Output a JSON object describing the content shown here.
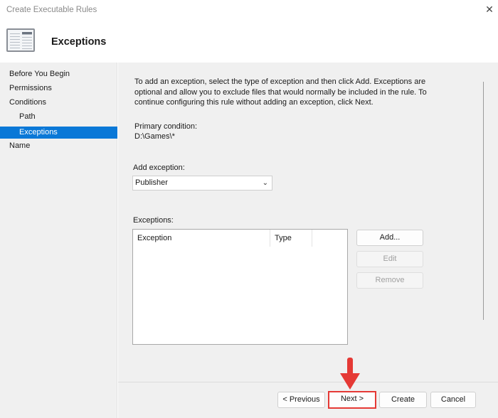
{
  "window": {
    "title": "Create Executable Rules",
    "close_icon": "close-icon"
  },
  "header": {
    "title": "Exceptions",
    "icon": "wizard-page-icon"
  },
  "sidebar": {
    "items": [
      {
        "label": "Before You Begin",
        "selected": false,
        "indent": false
      },
      {
        "label": "Permissions",
        "selected": false,
        "indent": false
      },
      {
        "label": "Conditions",
        "selected": false,
        "indent": false
      },
      {
        "label": "Path",
        "selected": false,
        "indent": true
      },
      {
        "label": "Exceptions",
        "selected": true,
        "indent": true
      },
      {
        "label": "Name",
        "selected": false,
        "indent": false
      }
    ]
  },
  "main": {
    "description_lines": [
      "To add an exception, select the type of exception and then click Add. Exceptions are",
      "optional and allow you to exclude files that would normally be included in the rule. To",
      "continue configuring this rule without adding an exception, click Next."
    ],
    "primary_condition_label": "Primary condition:",
    "primary_condition_value": "D:\\Games\\*",
    "add_exception_label": "Add exception:",
    "add_exception_value": "Publisher",
    "exceptions_label": "Exceptions:",
    "columns": [
      "Exception",
      "Type"
    ],
    "buttons": {
      "add": "Add...",
      "edit": "Edit",
      "remove": "Remove"
    }
  },
  "footer": {
    "previous": "< Previous",
    "next": "Next >",
    "create": "Create",
    "cancel": "Cancel"
  },
  "annotation": {
    "color": "#e53935",
    "target": "next-button"
  }
}
